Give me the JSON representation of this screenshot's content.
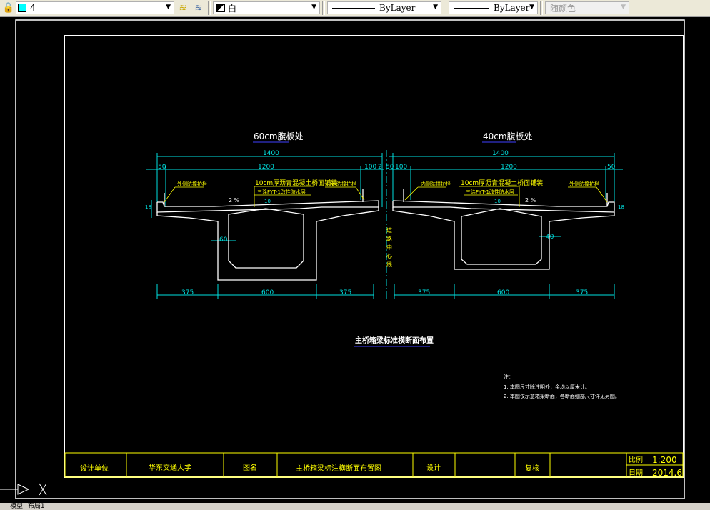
{
  "toolbar": {
    "layer_value": "4",
    "layer_color": "#00ffff",
    "color_value": "白",
    "linetype_value": "ByLayer",
    "lineweight_value": "ByLayer",
    "plotstyle_value": "随颜色"
  },
  "drawing": {
    "left_section": {
      "title": "60cm腹板处",
      "dim_total": "1400",
      "dim_left": "50",
      "dim_mid": "1200",
      "dim_right": "100",
      "dim_right2": "2",
      "dim_web": "60",
      "dim_h": "18",
      "dim_c": "10",
      "label_outer": "外侧防撞护栏",
      "label_inner": "内侧防撞护栏",
      "label_paving": "10cm厚沥青混凝土桥面铺装",
      "label_waterproof": "三涂FYT-1改性防水层",
      "slope": "2 %",
      "bottom_dims": [
        "375",
        "600",
        "375"
      ]
    },
    "right_section": {
      "title": "40cm腹板处",
      "dim_total": "1400",
      "dim_left": "50",
      "dim_left2": "100",
      "dim_mid": "1200",
      "dim_right": "50",
      "dim_web": "40",
      "dim_h": "18",
      "dim_c": "10",
      "label_inner": "内侧防撞护栏",
      "label_outer": "外侧防撞护栏",
      "label_paving": "10cm厚沥青混凝土桥面铺装",
      "label_waterproof": "三涂FYT-1改性防水层",
      "slope": "2 %",
      "bottom_dims": [
        "375",
        "600",
        "375"
      ]
    },
    "centerline_label": "道路中心线",
    "drawing_title": "主桥箱梁标准横断面布置",
    "notes": {
      "heading": "注：",
      "items": [
        "1. 本图尺寸除注明外，余均以厘米计。",
        "2. 本图仅示意箱梁断面，各断面细部尺寸详见另图。"
      ]
    },
    "title_block": {
      "design_unit_label": "设计单位",
      "design_unit": "华东交通大学",
      "drawing_name_label": "图名",
      "drawing_name": "主桥箱梁标注横断面布置图",
      "designer_label": "设计",
      "designer": "",
      "checker_label": "复核",
      "checker": "",
      "scale_label": "比例",
      "scale": "1:200",
      "date_label": "日期",
      "date": "2014.6"
    }
  },
  "tabs": [
    "模型",
    "布局1"
  ]
}
